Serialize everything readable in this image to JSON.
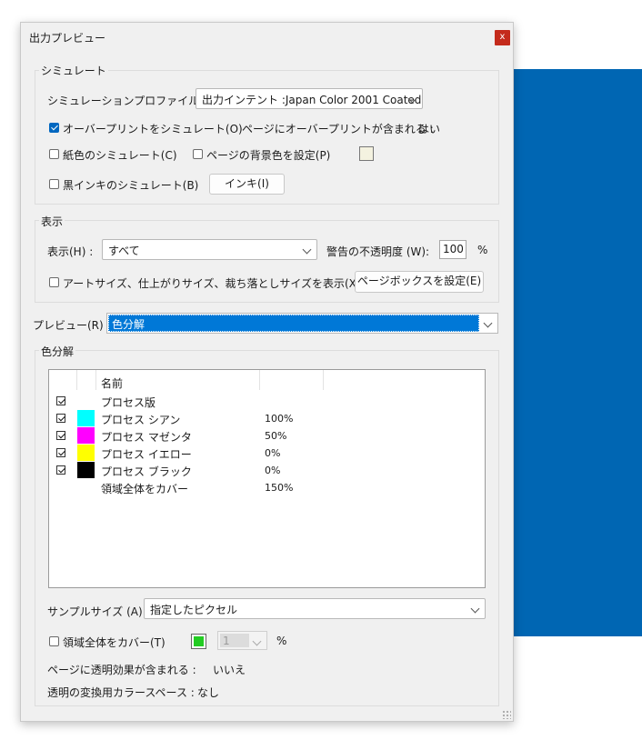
{
  "window": {
    "title": "出力プレビュー",
    "close_label": "x"
  },
  "simulate": {
    "group_label": "シミュレート",
    "profile_label": "シミュレーションプロファイル(S) :",
    "profile_value": "出力インテント :Japan Color 2001 Coated",
    "overprint_label": "オーバープリントをシミュレート(O)",
    "overprint_checked": true,
    "overprint_info_label": "ページにオーバープリントが含まれる :",
    "overprint_info_value": "はい",
    "paper_color_label": "紙色のシミュレート(C)",
    "paper_color_checked": false,
    "page_bg_label": "ページの背景色を設定(P)",
    "page_bg_checked": false,
    "page_bg_swatch_color": "#f4f2e0",
    "black_ink_label": "黒インキのシミュレート(B)",
    "black_ink_checked": false,
    "ink_button_label": "インキ(I)"
  },
  "display": {
    "group_label": "表示",
    "show_label": "表示(H) :",
    "show_value": "すべて",
    "opacity_label": "警告の不透明度 (W):",
    "opacity_value": "100",
    "opacity_unit": "%",
    "artsize_label": "アートサイズ、仕上がりサイズ、裁ち落としサイズを表示(X)",
    "artsize_checked": false,
    "pagebox_button_label": "ページボックスを設定(E)"
  },
  "preview": {
    "label": "プレビュー(R) :",
    "value": "色分解",
    "selected_bg": "#0078d7"
  },
  "separations": {
    "group_label": "色分解",
    "column_name": "名前",
    "rows": [
      {
        "checked": true,
        "color": "",
        "name": "プロセス版",
        "value": ""
      },
      {
        "checked": true,
        "color": "#00ffff",
        "name": "プロセス シアン",
        "value": "100%"
      },
      {
        "checked": true,
        "color": "#ff00ff",
        "name": "プロセス マゼンタ",
        "value": "50%"
      },
      {
        "checked": true,
        "color": "#ffff00",
        "name": "プロセス イエロー",
        "value": "0%"
      },
      {
        "checked": true,
        "color": "#000000",
        "name": "プロセス ブラック",
        "value": "0%"
      },
      {
        "checked": null,
        "color": "",
        "name": "領域全体をカバー",
        "value": "150%"
      }
    ],
    "sample_size_label": "サンプルサイズ (A):",
    "sample_size_value": "指定したピクセル",
    "coverage_label": "領域全体をカバー(T)",
    "coverage_checked": false,
    "coverage_swatch_color": "#22cc22",
    "coverage_value": "1",
    "coverage_unit": "%",
    "transparency_label": "ページに透明効果が含まれる :",
    "transparency_value": "いいえ",
    "blend_space_label": "透明の変換用カラースペース :",
    "blend_space_value": "なし"
  },
  "background_panel_color": "#0066b3"
}
